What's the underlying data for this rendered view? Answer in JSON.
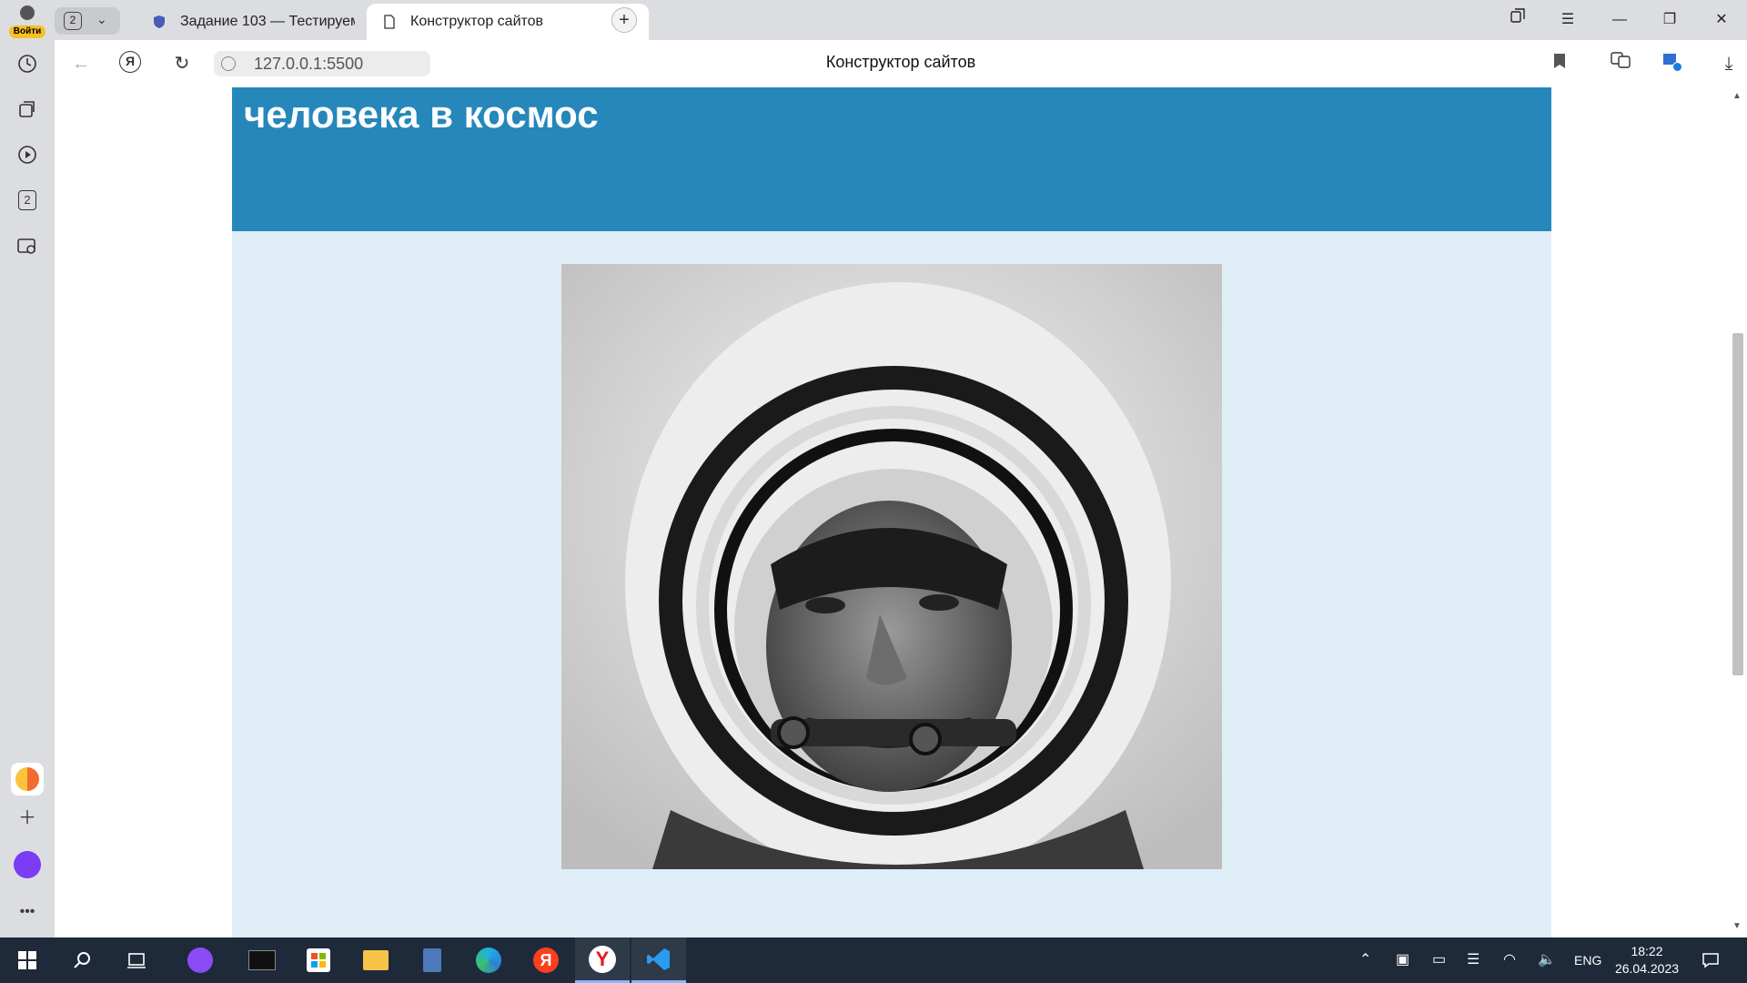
{
  "browser": {
    "login_label": "Войти",
    "tab_count": "2",
    "tabs": [
      {
        "label": "Задание 103 — Тестируем",
        "active": false
      },
      {
        "label": "Конструктор сайтов",
        "active": true
      }
    ],
    "url": "127.0.0.1:5500",
    "page_title": "Конструктор сайтов",
    "sidebar_tab_count": "2"
  },
  "page": {
    "hero_title": "человека в космос",
    "hero_color": "#2587ba",
    "content_bg": "#dfeef6"
  },
  "taskbar": {
    "language": "ENG",
    "time": "18:22",
    "date": "26.04.2023"
  }
}
